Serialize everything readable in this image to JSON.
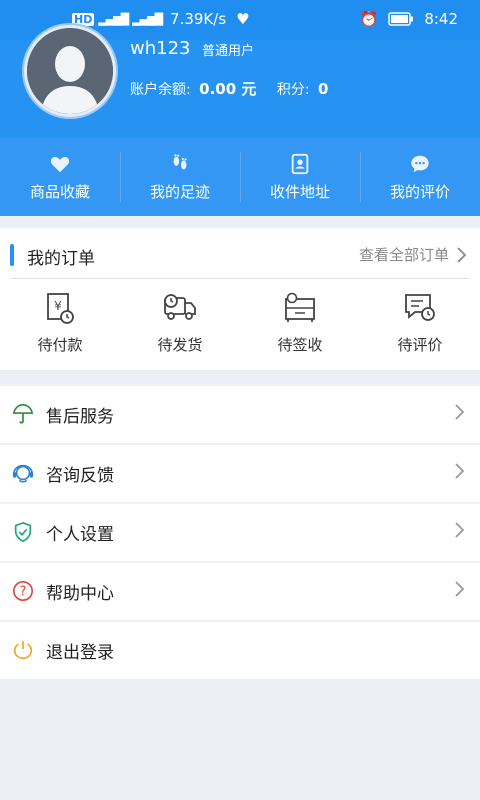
{
  "status_bar": {
    "network": "HD",
    "speed": "7.39K/s",
    "time": "8:42"
  },
  "profile": {
    "username": "wh123",
    "user_type": "普通用户",
    "balance_label": "账户余额:",
    "balance_value": "0.00 元",
    "points_label": "积分:",
    "points_value": "0"
  },
  "quick_links": [
    {
      "label": "商品收藏",
      "icon": "heart-icon"
    },
    {
      "label": "我的足迹",
      "icon": "footprints-icon"
    },
    {
      "label": "收件地址",
      "icon": "contact-book-icon"
    },
    {
      "label": "我的评价",
      "icon": "chat-bubble-icon"
    }
  ],
  "orders": {
    "title": "我的订单",
    "view_all": "查看全部订单",
    "items": [
      {
        "label": "待付款",
        "icon": "payment-icon"
      },
      {
        "label": "待发货",
        "icon": "truck-icon"
      },
      {
        "label": "待签收",
        "icon": "receive-box-icon"
      },
      {
        "label": "待评价",
        "icon": "review-icon"
      }
    ]
  },
  "menu": [
    {
      "label": "售后服务",
      "icon": "umbrella-icon",
      "color": "#2e8b3a"
    },
    {
      "label": "咨询反馈",
      "icon": "headset-icon",
      "color": "#2a7fd6"
    },
    {
      "label": "个人设置",
      "icon": "shield-check-icon",
      "color": "#1aa86e"
    },
    {
      "label": "帮助中心",
      "icon": "help-circle-icon",
      "color": "#e0463c"
    },
    {
      "label": "退出登录",
      "icon": "power-icon",
      "color": "#f2a51f"
    }
  ],
  "colors": {
    "header_blue": "#2692f2",
    "quick_blue": "#3397f3"
  }
}
